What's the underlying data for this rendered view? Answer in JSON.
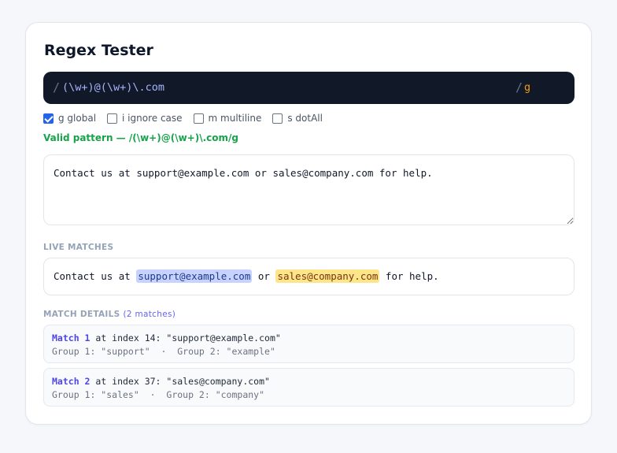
{
  "app": {
    "title": "Regex Tester"
  },
  "pattern": {
    "open_slash": "/",
    "value": "(\\w+)@(\\w+)\\.com",
    "close_slash": "/",
    "flags": "g"
  },
  "flag_options": [
    {
      "label": "g global",
      "checked": true
    },
    {
      "label": "i ignore case",
      "checked": false
    },
    {
      "label": "m multiline",
      "checked": false
    },
    {
      "label": "s dotAll",
      "checked": false
    }
  ],
  "status": {
    "text": "Valid pattern — /(\\w+)@(\\w+)\\.com/g",
    "color": "#16a34a"
  },
  "test_string": "Contact us at support@example.com or sales@company.com for help.",
  "live_matches": {
    "label": "LIVE MATCHES",
    "before": "Contact us at ",
    "match1": "support@example.com",
    "between": " or ",
    "match2": "sales@company.com",
    "after": " for help."
  },
  "match_details": {
    "label": "MATCH DETAILS",
    "count": "(2 matches)",
    "matches": [
      {
        "title": "Match 1",
        "info": " at index 14: \"support@example.com\"",
        "groups": "Group 1: \"support\"  ·  Group 2: \"example\""
      },
      {
        "title": "Match 2",
        "info": " at index 37: \"sales@company.com\"",
        "groups": "Group 1: \"sales\"  ·  Group 2: \"company\""
      }
    ]
  },
  "colors": {
    "accent": "#2563eb",
    "pattern_bg": "#111827",
    "highlight1": "#c7d2fe",
    "highlight2": "#fde68a"
  }
}
